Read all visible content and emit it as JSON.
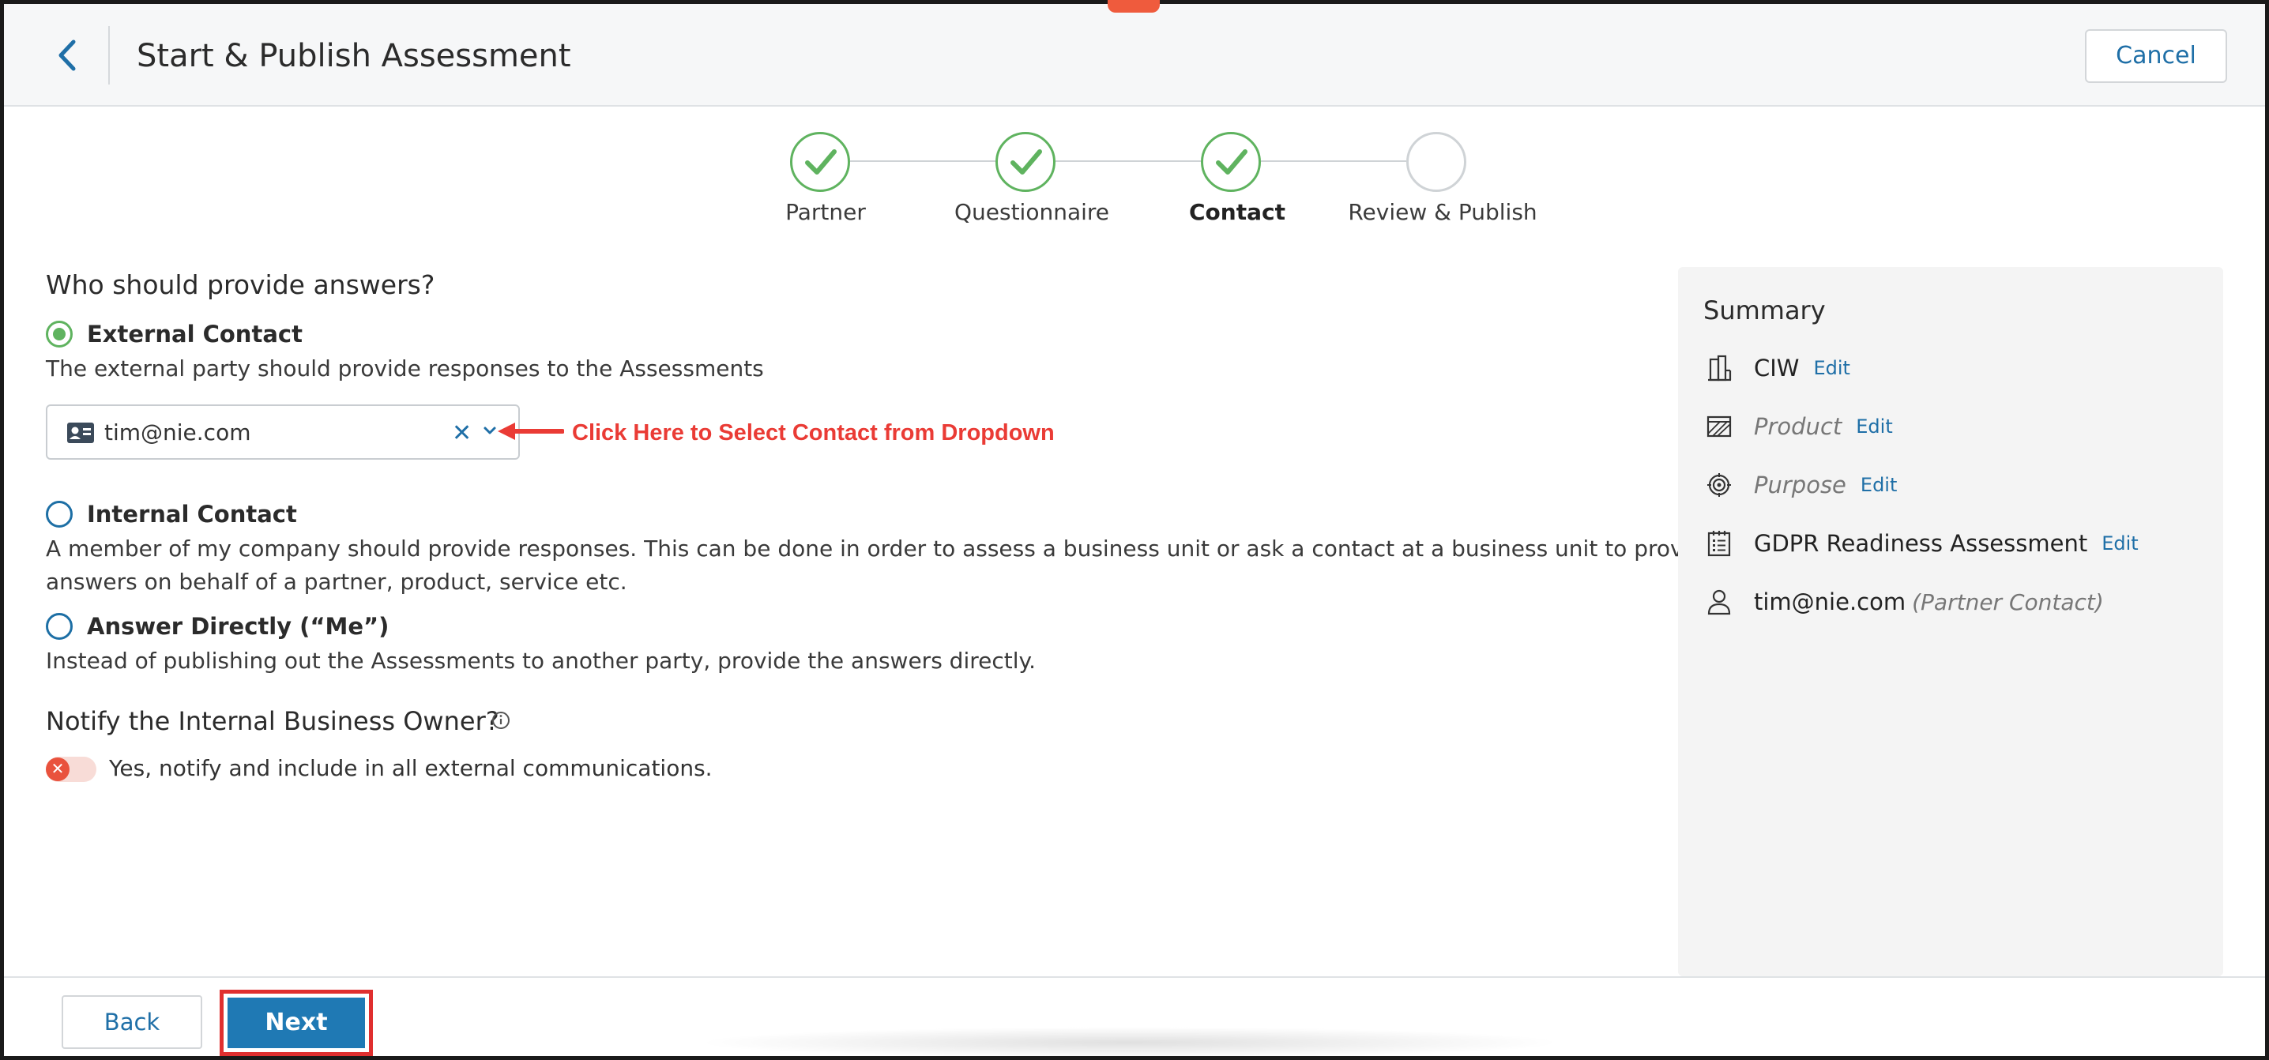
{
  "header": {
    "title": "Start & Publish Assessment",
    "cancel_label": "Cancel"
  },
  "stepper": {
    "steps": [
      {
        "label": "Partner",
        "status": "complete"
      },
      {
        "label": "Questionnaire",
        "status": "complete"
      },
      {
        "label": "Contact",
        "status": "complete",
        "active": true
      },
      {
        "label": "Review & Publish",
        "status": "pending"
      }
    ]
  },
  "main": {
    "question": "Who should provide answers?",
    "options": [
      {
        "label": "External Contact",
        "selected": true,
        "description": "The external party should provide responses to the Assessments"
      },
      {
        "label": "Internal Contact",
        "selected": false,
        "description_line1": "A member of my company should provide responses. This can be done in order to assess a business unit or ask a contact at a business unit to provide",
        "description_line2": "answers on behalf of a partner, product, service etc."
      },
      {
        "label": "Answer Directly (“Me”)",
        "selected": false,
        "description": "Instead of publishing out the Assessments to another party, provide the answers directly."
      }
    ],
    "contact_select": {
      "value": "tim@nie.com",
      "clear_icon": "close-icon",
      "dropdown_icon": "chevron-down-icon"
    },
    "annotation": "Click Here to Select Contact from Dropdown",
    "notify": {
      "title": "Notify the Internal Business Owner?",
      "toggle_on": false,
      "toggle_label": "Yes, notify and include in all external communications."
    }
  },
  "summary": {
    "title": "Summary",
    "rows": [
      {
        "icon": "building-icon",
        "text": "CIW",
        "placeholder": false,
        "edit": "Edit"
      },
      {
        "icon": "product-icon",
        "text": "Product",
        "placeholder": true,
        "edit": "Edit"
      },
      {
        "icon": "target-icon",
        "text": "Purpose",
        "placeholder": true,
        "edit": "Edit"
      },
      {
        "icon": "checklist-icon",
        "text": "GDPR Readiness Assessment",
        "placeholder": false,
        "edit": "Edit"
      },
      {
        "icon": "person-icon",
        "text": "tim@nie.com",
        "note": "(Partner Contact)"
      }
    ]
  },
  "footer": {
    "back_label": "Back",
    "next_label": "Next"
  },
  "colors": {
    "accent_blue": "#1f79b4",
    "success_green": "#5fb35f",
    "annotation_red": "#ea3b35",
    "toggle_off_red": "#e9523d"
  }
}
